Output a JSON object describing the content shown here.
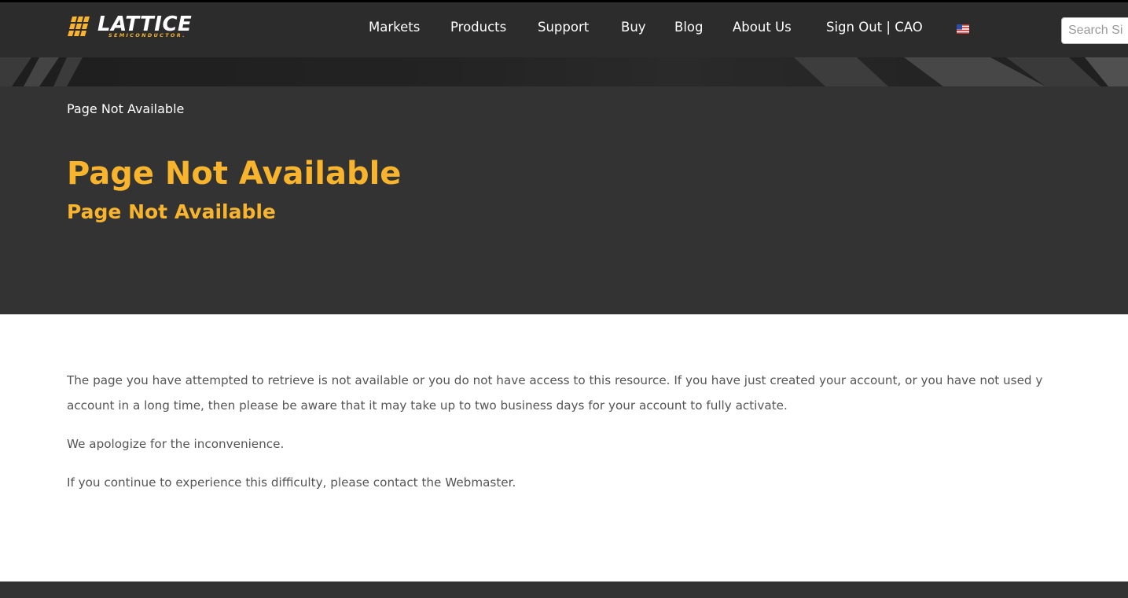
{
  "header": {
    "logo": {
      "wordmark": "LATTICE",
      "tagline": "SEMICONDUCTOR."
    },
    "nav": [
      {
        "label": "Markets"
      },
      {
        "label": "Products"
      },
      {
        "label": "Support"
      },
      {
        "label": "Buy"
      },
      {
        "label": "Blog"
      },
      {
        "label": "About Us"
      },
      {
        "label": "Sign Out | CAO"
      }
    ],
    "language_flag": "us-flag-icon",
    "search": {
      "placeholder": "Search Si",
      "value": ""
    }
  },
  "hero": {
    "breadcrumb": "Page Not Available",
    "title": "Page Not Available",
    "subtitle": "Page Not Available"
  },
  "main": {
    "paragraph1_line1": "The page you have attempted to retrieve is not available or you do not have access to this resource. If you have just created your account, or you have not used y",
    "paragraph1_line2": "account in a long time, then please be aware that it may take up to two business days for your account to fully activate.",
    "paragraph2": "We apologize for the inconvenience.",
    "paragraph3": "If you continue to experience this difficulty, please contact the Webmaster."
  },
  "colors": {
    "accent": "#f7b42c",
    "header_bg": "#2c2c2c",
    "hero_bg": "#333333",
    "body_text": "#555555"
  }
}
